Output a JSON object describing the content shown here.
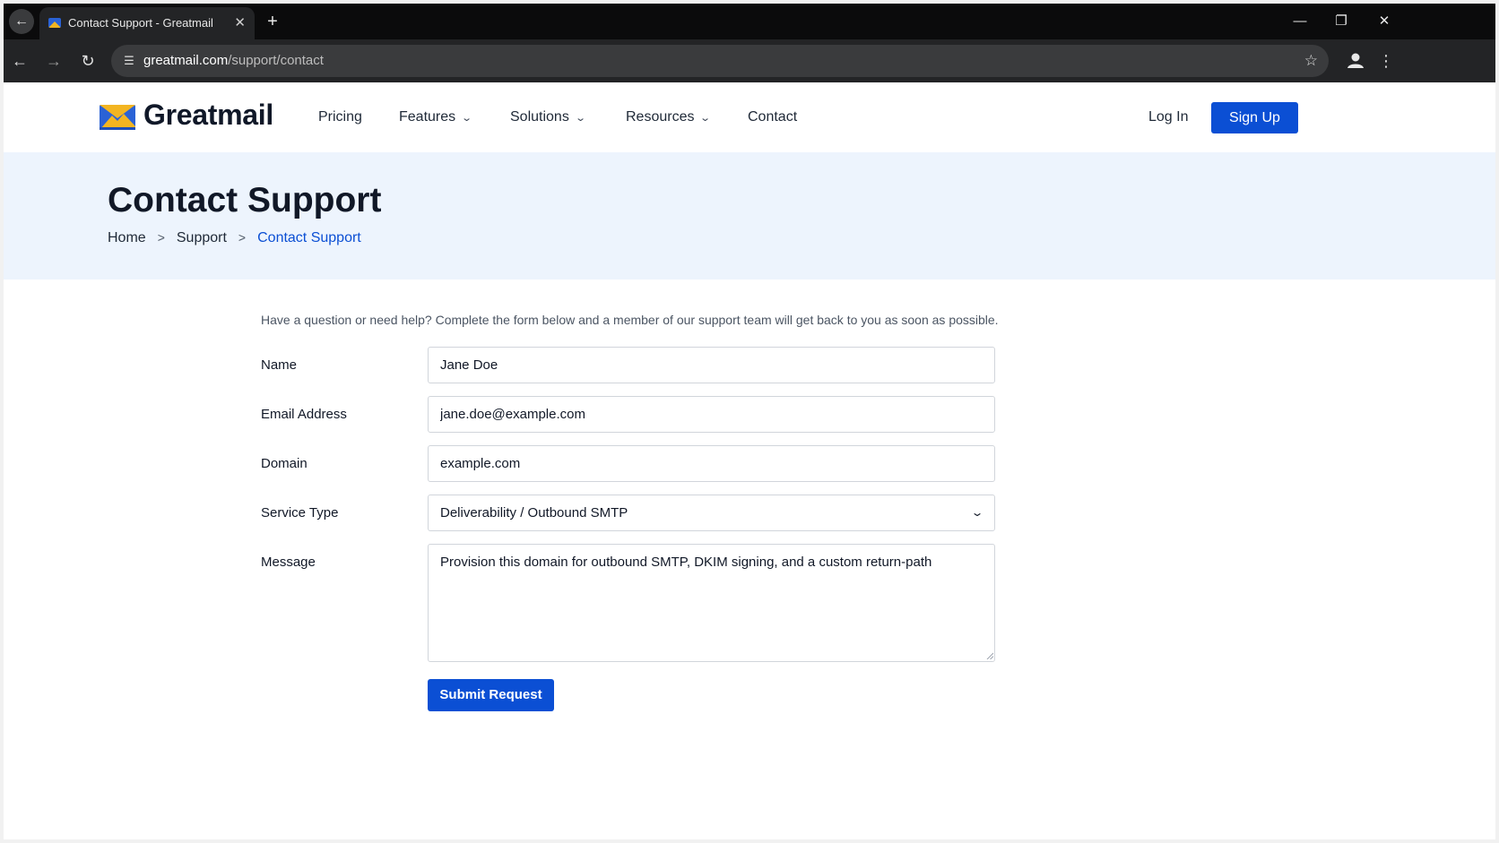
{
  "browser": {
    "tab_title": "Contact Support - Greatmail",
    "url_host": "greatmail.com",
    "url_path": "/support/contact"
  },
  "header": {
    "brand": "Greatmail",
    "nav": [
      {
        "label": "Pricing"
      },
      {
        "label": "Features",
        "dropdown": true
      },
      {
        "label": "Solutions",
        "dropdown": true
      },
      {
        "label": "Resources",
        "dropdown": true
      },
      {
        "label": "Contact"
      }
    ],
    "login_label": "Log In",
    "signup_label": "Sign Up"
  },
  "hero": {
    "title": "Contact Support",
    "breadcrumb": [
      "Home",
      "Support",
      "Contact Support"
    ]
  },
  "form": {
    "intro": "Have a question or need help? Complete the form below and a member of our support team will get back to you as soon as possible.",
    "name": {
      "label": "Name",
      "value": "Jane Doe"
    },
    "email": {
      "label": "Email Address",
      "value": "jane.doe@example.com"
    },
    "domain": {
      "label": "Domain",
      "value": "example.com"
    },
    "service_type": {
      "label": "Service Type",
      "value": "Deliverability / Outbound SMTP"
    },
    "message": {
      "label": "Message",
      "value": "Provision this domain for outbound SMTP, DKIM signing, and a custom return-path"
    },
    "submit_label": "Submit Request"
  },
  "colors": {
    "accent": "#0b4fd4",
    "hero_bg": "#edf4fd",
    "logo_blue": "#2a62d6",
    "logo_yellow": "#f3b521"
  },
  "icons": [
    "back-arrow-icon",
    "favicon-icon",
    "close-icon",
    "plus-icon",
    "minimize-icon",
    "restore-icon",
    "forward-arrow-icon",
    "reload-icon",
    "site-settings-icon",
    "star-icon",
    "profile-icon",
    "menu-kebab-icon",
    "chevron-down-icon",
    "resize-grip-icon"
  ]
}
